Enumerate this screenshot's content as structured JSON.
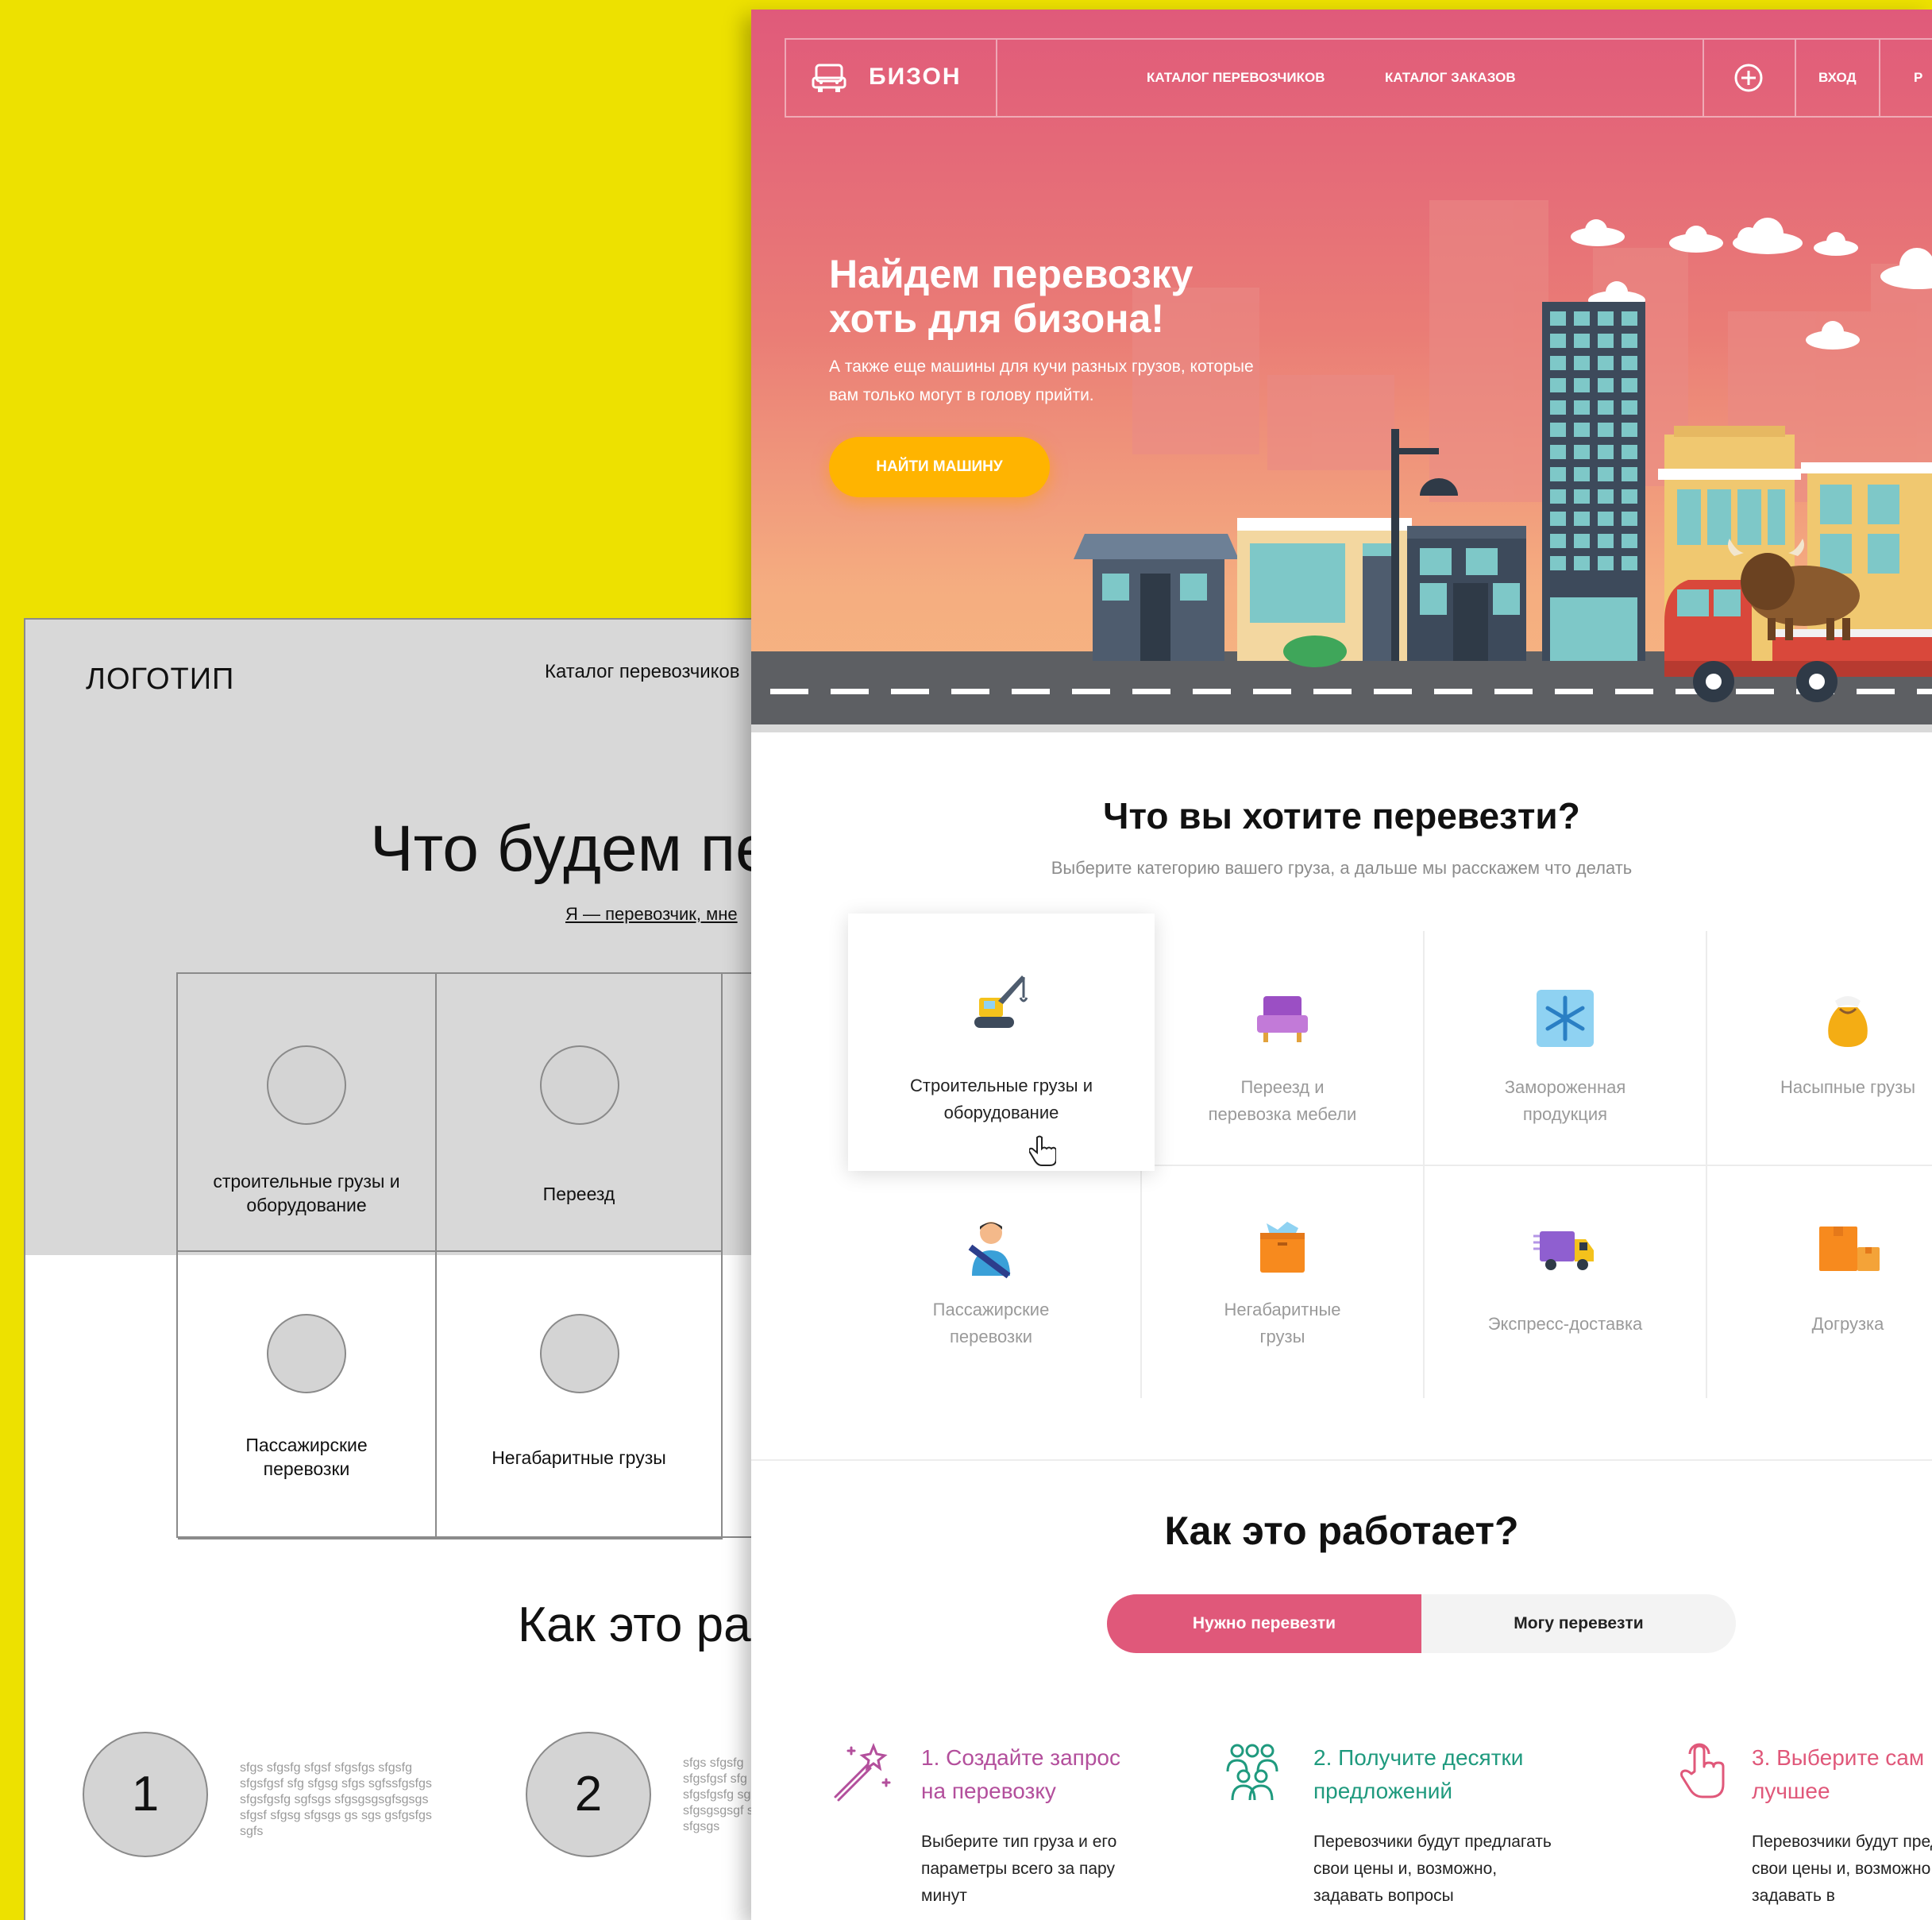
{
  "wireframe": {
    "logo": "ЛОГОТИП",
    "nav_catalog": "Каталог перевозчиков",
    "title": "Что будем пе",
    "carrier_link": "Я — перевозчик, мне",
    "categories": [
      "строительные грузы и оборудование",
      "Переезд",
      "Пассажирские перевозки",
      "Негабаритные грузы"
    ],
    "how_title": "Как это ра",
    "steps": [
      {
        "number": "1",
        "lorem": "sfgs sfgsfg sfgsf sfgsfgs sfgsfg sfgsfgsf sfg sfgsg sfgs sgfssfgsfgs sfgsfgsfg sgfsgs sfgsgsgsgfsgsgs sfgsf sfgsg sfgsgs gs sgs gsfgsfgs sgfs"
      },
      {
        "number": "2",
        "lorem": "sfgs sfgsfg sfgsfgsf sfg sfgsfgsfg sg sfgsgsgsgf sfgsg sfgsgs"
      }
    ]
  },
  "design": {
    "brand": "БИЗОН",
    "nav": {
      "carriers": "КАТАЛОГ ПЕРЕВОЗЧИКОВ",
      "orders": "КАТАЛОГ ЗАКАЗОВ",
      "login": "ВХОД",
      "register_partial": "Р"
    },
    "hero": {
      "title_line1": "Найдем перевозку",
      "title_line2": "хоть для бизона!",
      "subtitle": "А также еще машины для кучи разных грузов, которые вам только могут в голову прийти.",
      "cta": "НАЙТИ МАШИНУ"
    },
    "categories_section": {
      "title": "Что вы хотите перевезти?",
      "subtitle": "Выберите категорию вашего груза, а дальше мы расскажем что делать",
      "items": [
        {
          "label": "Строительные грузы и оборудование",
          "icon": "crane-icon"
        },
        {
          "label": "Переезд и перевозка мебели",
          "icon": "armchair-icon"
        },
        {
          "label": "Замороженная продукция",
          "icon": "snowflake-icon"
        },
        {
          "label": "Насыпные грузы",
          "icon": "sack-icon"
        },
        {
          "label": "Пассажирские перевозки",
          "icon": "passenger-icon"
        },
        {
          "label": "Негабаритные грузы",
          "icon": "box-icon"
        },
        {
          "label": "Экспресс-доставка",
          "icon": "delivery-truck-icon"
        },
        {
          "label": "Догрузка",
          "icon": "parcels-icon"
        }
      ]
    },
    "how_section": {
      "title": "Как это работает?",
      "tab_need": "Нужно перевезти",
      "tab_can": "Могу перевезти",
      "steps": [
        {
          "title_line1": "1. Создайте запрос",
          "title_line2": "на перевозку",
          "text": "Выберите тип груза и его параметры всего за пару минут",
          "color": "#b34f9c",
          "icon": "magic-wand-icon"
        },
        {
          "title_line1": "2. Получите десятки",
          "title_line2": "предложений",
          "text": "Перевозчики будут предлагать свои цены и, возможно, задавать вопросы",
          "color": "#1f9a7e",
          "icon": "people-group-icon"
        },
        {
          "title_line1": "3. Выберите сам",
          "title_line2": "лучшее",
          "text": "Перевозчики будут предлагать свои цены и, возможно, задавать в",
          "color": "#e0587a",
          "icon": "pointing-hand-icon"
        }
      ]
    },
    "colors": {
      "accent_pink": "#e0587a",
      "cta_yellow": "#ffb400",
      "backdrop_yellow": "#ede100"
    }
  }
}
